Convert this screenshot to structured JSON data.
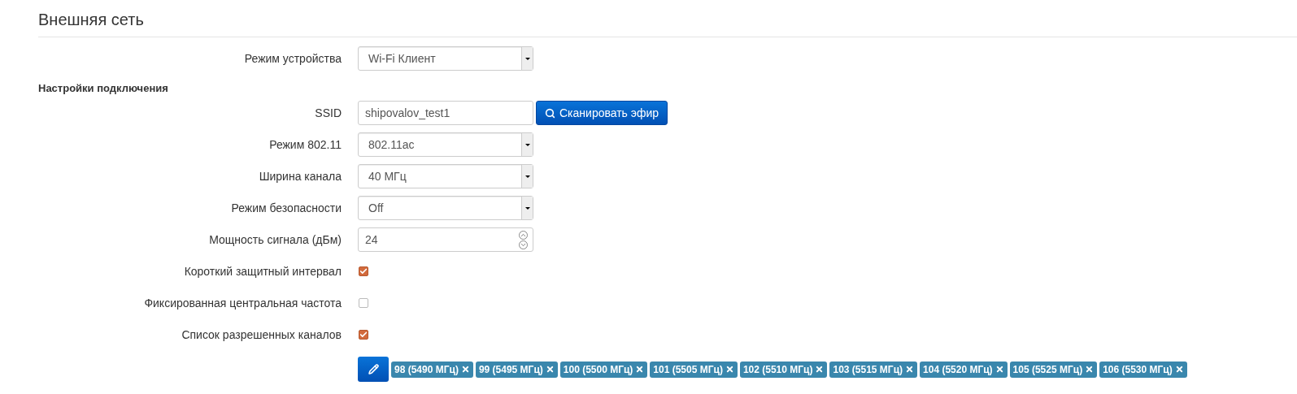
{
  "title": "Внешняя сеть",
  "device_mode": {
    "label": "Режим устройства",
    "value": "Wi-Fi Клиент"
  },
  "section": "Настройки подключения",
  "fields": [
    {
      "kind": "text",
      "label": "SSID",
      "value": "shipovalov_test1",
      "button": "Сканировать эфир"
    },
    {
      "kind": "select",
      "label": "Режим 802.11",
      "value": "802.11ac"
    },
    {
      "kind": "select",
      "label": "Ширина канала",
      "value": "40 МГц"
    },
    {
      "kind": "select",
      "label": "Режим безопасности",
      "value": "Off"
    },
    {
      "kind": "number",
      "label": "Мощность сигнала (дБм)",
      "value": "24"
    },
    {
      "kind": "checkbox",
      "label": "Короткий защитный интервал",
      "checked": true
    },
    {
      "kind": "checkbox",
      "label": "Фиксированная центральная частота",
      "checked": false
    },
    {
      "kind": "checkbox",
      "label": "Список разрешенных каналов",
      "checked": true
    }
  ],
  "channels": [
    "98 (5490 МГц)",
    "99 (5495 МГц)",
    "100 (5500 МГц)",
    "101 (5505 МГц)",
    "102 (5510 МГц)",
    "103 (5515 МГц)",
    "104 (5520 МГц)",
    "105 (5525 МГц)",
    "106 (5530 МГц)"
  ]
}
